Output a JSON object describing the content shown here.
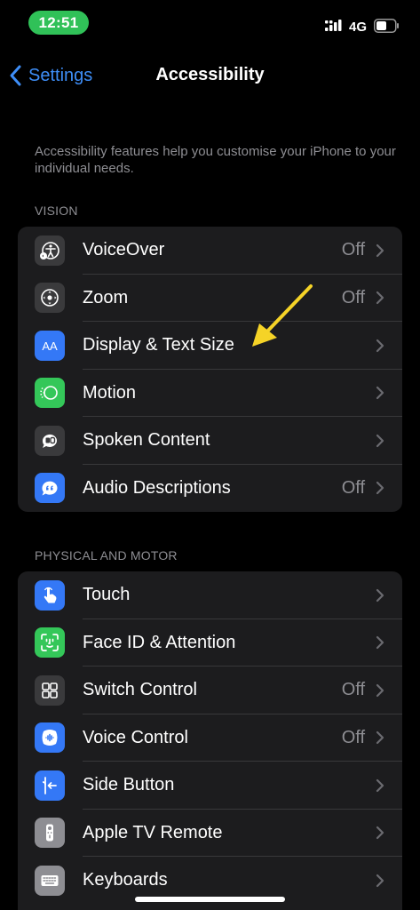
{
  "status_bar": {
    "time": "12:51",
    "network": "4G"
  },
  "nav": {
    "back_label": "Settings",
    "title": "Accessibility"
  },
  "description": "Accessibility features help you customise your iPhone to your individual needs.",
  "sections": {
    "vision": {
      "header": "VISION",
      "items": [
        {
          "label": "VoiceOver",
          "value": "Off",
          "icon": "voiceover-icon",
          "color": "#3a3a3c"
        },
        {
          "label": "Zoom",
          "value": "Off",
          "icon": "zoom-icon",
          "color": "#3a3a3c"
        },
        {
          "label": "Display & Text Size",
          "value": "",
          "icon": "display-text-size-icon",
          "color": "#3478f6"
        },
        {
          "label": "Motion",
          "value": "",
          "icon": "motion-icon",
          "color": "#34c759"
        },
        {
          "label": "Spoken Content",
          "value": "",
          "icon": "spoken-content-icon",
          "color": "#3a3a3c"
        },
        {
          "label": "Audio Descriptions",
          "value": "Off",
          "icon": "audio-descriptions-icon",
          "color": "#3478f6"
        }
      ]
    },
    "physical": {
      "header": "PHYSICAL AND MOTOR",
      "items": [
        {
          "label": "Touch",
          "value": "",
          "icon": "touch-icon",
          "color": "#3478f6"
        },
        {
          "label": "Face ID & Attention",
          "value": "",
          "icon": "face-id-icon",
          "color": "#34c759"
        },
        {
          "label": "Switch Control",
          "value": "Off",
          "icon": "switch-control-icon",
          "color": "#3a3a3c"
        },
        {
          "label": "Voice Control",
          "value": "Off",
          "icon": "voice-control-icon",
          "color": "#3478f6"
        },
        {
          "label": "Side Button",
          "value": "",
          "icon": "side-button-icon",
          "color": "#3478f6"
        },
        {
          "label": "Apple TV Remote",
          "value": "",
          "icon": "apple-tv-remote-icon",
          "color": "#8e8e93"
        },
        {
          "label": "Keyboards",
          "value": "",
          "icon": "keyboard-icon",
          "color": "#8e8e93"
        }
      ]
    }
  },
  "colors": {
    "accent": "#3e8ef7",
    "annotation_arrow": "#f5d327"
  }
}
